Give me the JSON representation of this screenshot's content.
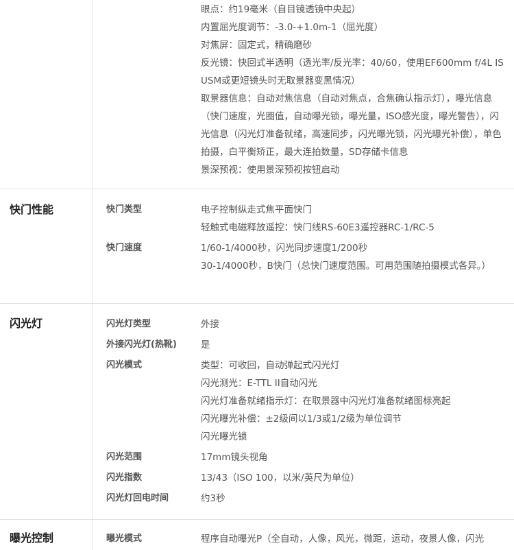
{
  "viewfinder_tail": [
    "眼点：约19毫米（自目镜透镜中央起）",
    "内置屈光度调节：-3.0-+1.0m-1（屈光度）",
    "对焦屏：固定式，精确磨砂",
    "反光镜：快回式半透明（透光率/反光率：40/60，使用EF600mm f/4L IS USM或更短镜头时无取景器变黑情况）",
    "取景器信息：自动对焦信息（自动对焦点，合焦确认指示灯），曝光信息（快门速度，光圈值，自动曝光锁，曝光量，ISO感光度，曝光警告），闪光信息（闪光灯准备就绪，高速同步，闪光曝光锁，闪光曝光补偿），单色拍摄，白平衡矫正，最大连拍数量，SD存储卡信息",
    "景深预视：使用景深预视按钮启动"
  ],
  "shutter": {
    "title": "快门性能",
    "type_label": "快门类型",
    "type_values": [
      "电子控制纵走式焦平面快门",
      "轻触式电磁释放遥控：快门线RS-60E3遥控器RC-1/RC-5"
    ],
    "speed_label": "快门速度",
    "speed_values": [
      "1/60-1/4000秒，闪光同步速度1/200秒",
      "30-1/4000秒，B快门（总快门速度范围。可用范围随拍摄模式各异。）"
    ]
  },
  "flash": {
    "title": "闪光灯",
    "type_label": "闪光灯类型",
    "type_value": "外接",
    "hotshoe_label": "外接闪光灯(热靴)",
    "hotshoe_value": "是",
    "mode_label": "闪光模式",
    "mode_values": [
      "类型：可收回，自动弹起式闪光灯",
      "闪光测光：E-TTL II自动闪光",
      "闪光灯准备就绪指示灯：在取景器中闪光灯准备就绪图标亮起",
      "闪光曝光补偿：±2级间以1/3或1/2级为单位调节",
      "闪光曝光锁"
    ],
    "range_label": "闪光范围",
    "range_value": "17mm镜头视角",
    "gn_label": "闪光指数",
    "gn_value": "13/43（ISO 100，以米/英尺为单位）",
    "recycle_label": "闪光灯回电时间",
    "recycle_value": "约3秒"
  },
  "exposure": {
    "title": "曝光控制",
    "mode_label": "曝光模式",
    "mode_value": "程序自动曝光P（全自动，人像，风光，微距，运动，夜景人像，闪光"
  }
}
